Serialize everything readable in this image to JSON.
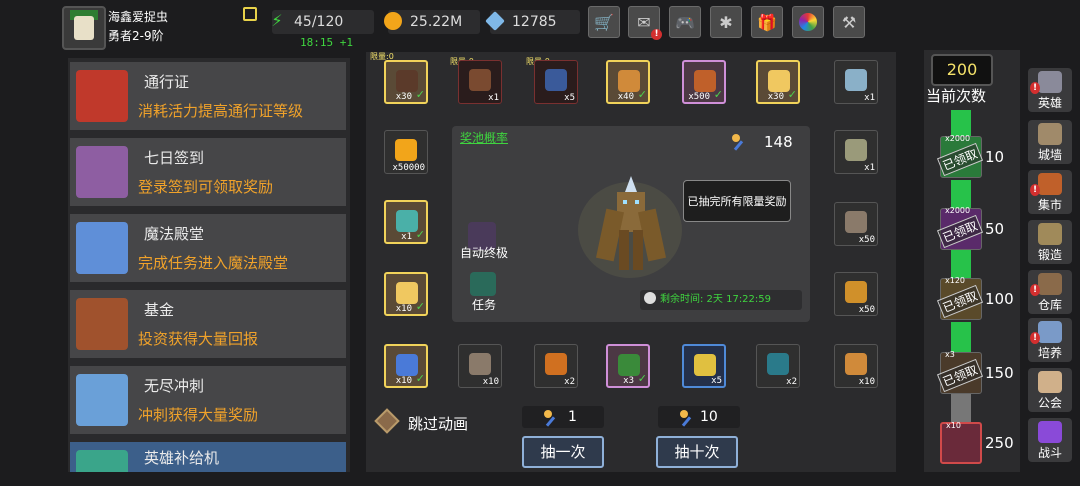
{
  "player": {
    "name": "海鑫爱捉虫",
    "rank": "勇者2-9阶"
  },
  "resources": {
    "energy": "45/120",
    "energy_timer": "18:15 +1",
    "gold": "25.22M",
    "gems": "12785"
  },
  "top_buttons": [
    "shop-icon",
    "mail-icon",
    "gamepad-icon",
    "gear-icon",
    "gift-icon",
    "color-wheel-icon",
    "tools-icon"
  ],
  "left_menu": [
    {
      "title": "通行证",
      "desc": "消耗活力提高通行证等级",
      "icon": "chalice-icon",
      "color": "#c0392b"
    },
    {
      "title": "七日签到",
      "desc": "登录签到可领取奖励",
      "icon": "chest-icon",
      "color": "#8e5ea2"
    },
    {
      "title": "魔法殿堂",
      "desc": "完成任务进入魔法殿堂",
      "icon": "crystal-icon",
      "color": "#5f8fd8"
    },
    {
      "title": "基金",
      "desc": "投资获得大量回报",
      "icon": "merchant-icon",
      "color": "#a0522d"
    },
    {
      "title": "无尽冲刺",
      "desc": "冲刺获得大量奖励",
      "icon": "hero-icon",
      "color": "#6aa0d8"
    },
    {
      "title": "英雄补给机",
      "desc": "",
      "icon": "machine-icon",
      "color": "#3aa58a"
    }
  ],
  "limit_labels": [
    "限量:0",
    "限量:0",
    "限量:0"
  ],
  "top_row": [
    {
      "count": "x30",
      "frame": "gold",
      "color": "#5b3a2a",
      "done": true
    },
    {
      "count": "x1",
      "frame": "red",
      "color": "#7a4a30",
      "done": false
    },
    {
      "count": "x5",
      "frame": "red",
      "color": "#3a5a9a",
      "done": false
    },
    {
      "count": "x40",
      "frame": "gold",
      "color": "#d08a3a",
      "done": true
    },
    {
      "count": "x500",
      "frame": "purple",
      "color": "#c0602a",
      "done": true
    },
    {
      "count": "x30",
      "frame": "gold",
      "color": "#f0c860",
      "done": true
    },
    {
      "count": "x1",
      "frame": "dark",
      "color": "#8ab0c8",
      "done": false
    }
  ],
  "left_col": [
    {
      "count": "x50000",
      "frame": "dark",
      "color": "#f2a51a",
      "done": false
    },
    {
      "count": "x1",
      "frame": "gold",
      "color": "#4ab0a8",
      "done": true
    },
    {
      "count": "x10",
      "frame": "gold",
      "color": "#f0c860",
      "done": true
    }
  ],
  "right_col": [
    {
      "count": "x1",
      "frame": "dark",
      "color": "#9a9a7a",
      "done": false
    },
    {
      "count": "x50",
      "frame": "dark",
      "color": "#8a7a6a",
      "done": false
    },
    {
      "count": "x50",
      "frame": "dark",
      "color": "#d0902a",
      "done": false
    }
  ],
  "bottom_row": [
    {
      "count": "x10",
      "frame": "gold",
      "color": "#4a7ad8",
      "done": true
    },
    {
      "count": "x10",
      "frame": "dark",
      "color": "#8a7a6a",
      "done": false
    },
    {
      "count": "x2",
      "frame": "dark",
      "color": "#d07020",
      "done": false
    },
    {
      "count": "x3",
      "frame": "purple",
      "color": "#3a8a3a",
      "done": true
    },
    {
      "count": "x5",
      "frame": "blue",
      "color": "#e0c040",
      "done": false
    },
    {
      "count": "x2",
      "frame": "dark",
      "color": "#2a7a8a",
      "done": false
    },
    {
      "count": "x10",
      "frame": "dark",
      "color": "#d08a3a",
      "done": false
    }
  ],
  "pool": {
    "title": "奖池概率",
    "wand_count": "148",
    "tooltip": "已抽完所有限量奖励",
    "auto_label": "自动终极",
    "task_label": "任务",
    "remaining": "剩余时间: 2天 17:22:59"
  },
  "controls": {
    "skip_label": "跳过动画",
    "cost_one": "1",
    "cost_ten": "10",
    "draw_one": "抽一次",
    "draw_ten": "抽十次"
  },
  "progress": {
    "count": "200",
    "label": "当前次数",
    "claimed_label": "已领取",
    "milestones": [
      {
        "threshold": "10",
        "reward_count": "x2000",
        "color": "#2a7a3a",
        "claimed": true
      },
      {
        "threshold": "50",
        "reward_count": "x2000",
        "color": "#5a2a6a",
        "claimed": true
      },
      {
        "threshold": "100",
        "reward_count": "x120",
        "color": "#5a4a2a",
        "claimed": true
      },
      {
        "threshold": "150",
        "reward_count": "x3",
        "color": "#4a3a2a",
        "claimed": true
      },
      {
        "threshold": "250",
        "reward_count": "x10",
        "color": "#6a2a3a",
        "claimed": false
      }
    ]
  },
  "side_nav": [
    {
      "label": "英雄",
      "icon": "helmet-icon",
      "color": "#8a8a9a",
      "alert": true
    },
    {
      "label": "城墙",
      "icon": "wall-icon",
      "color": "#a08a6a",
      "alert": false
    },
    {
      "label": "集市",
      "icon": "market-icon",
      "color": "#c0602a",
      "alert": true
    },
    {
      "label": "锻造",
      "icon": "anvil-icon",
      "color": "#a08a5a",
      "alert": false
    },
    {
      "label": "仓库",
      "icon": "warehouse-icon",
      "color": "#8a6a4a",
      "alert": true
    },
    {
      "label": "培养",
      "icon": "flask-icon",
      "color": "#7a9ac8",
      "alert": true
    },
    {
      "label": "公会",
      "icon": "guild-icon",
      "color": "#d0b08a",
      "alert": false
    },
    {
      "label": "战斗",
      "icon": "portal-icon",
      "color": "#8a4ad8",
      "alert": false
    }
  ]
}
